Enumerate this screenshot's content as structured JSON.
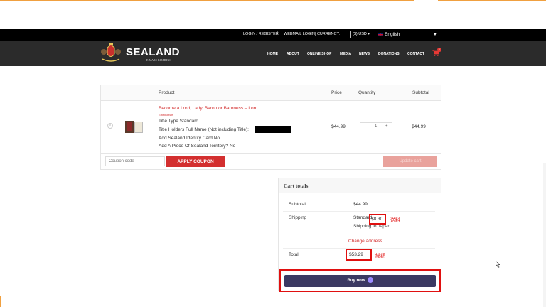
{
  "utility": {
    "login": "LOGIN / REGISTER",
    "sep": "|",
    "webmail": "WEBMAIL LOGIN",
    "currency_label": "| CURRENCY:",
    "currency_value": "($) USD",
    "language": "English"
  },
  "brand": {
    "name": "SEALAND",
    "motto": "E MARE LIBERTAS"
  },
  "nav": {
    "items": [
      "HOME",
      "ABOUT",
      "ONLINE SHOP",
      "MEDIA",
      "NEWS",
      "DONATIONS",
      "CONTACT"
    ],
    "cart_count": "1"
  },
  "cart": {
    "headers": {
      "product": "Product",
      "price": "Price",
      "quantity": "Quantity",
      "subtotal": "Subtotal"
    },
    "item": {
      "remove": "×",
      "name": "Become a Lord, Lady, Baron or Baroness – Lord",
      "edit": "Edit options",
      "title_type": "Title Type Standard",
      "holder_name": "Title Holders Full Name (Not including Title):",
      "identity_card": "Add Sealand Identity Card No",
      "territory": "Add A Piece Of Sealand Territory? No",
      "price": "$44.99",
      "qty_minus": "-",
      "qty_value": "1",
      "qty_plus": "+",
      "subtotal": "$44.99"
    },
    "coupon_placeholder": "Coupon code",
    "apply_label": "APPLY COUPON",
    "update_label": "Update cart"
  },
  "totals": {
    "title": "Cart totals",
    "subtotal_label": "Subtotal",
    "subtotal_value": "$44.99",
    "shipping_label": "Shipping",
    "shipping_prefix": "Standard:",
    "shipping_amount": "$8.30",
    "shipping_note_jp": "送料",
    "shipping_to": "Shipping to Japan.",
    "change_address": "Change address",
    "total_label": "Total",
    "total_value": "$53.29",
    "total_note_jp": "総額",
    "buy_label": "Buy now",
    "buy_arrow": "›"
  }
}
